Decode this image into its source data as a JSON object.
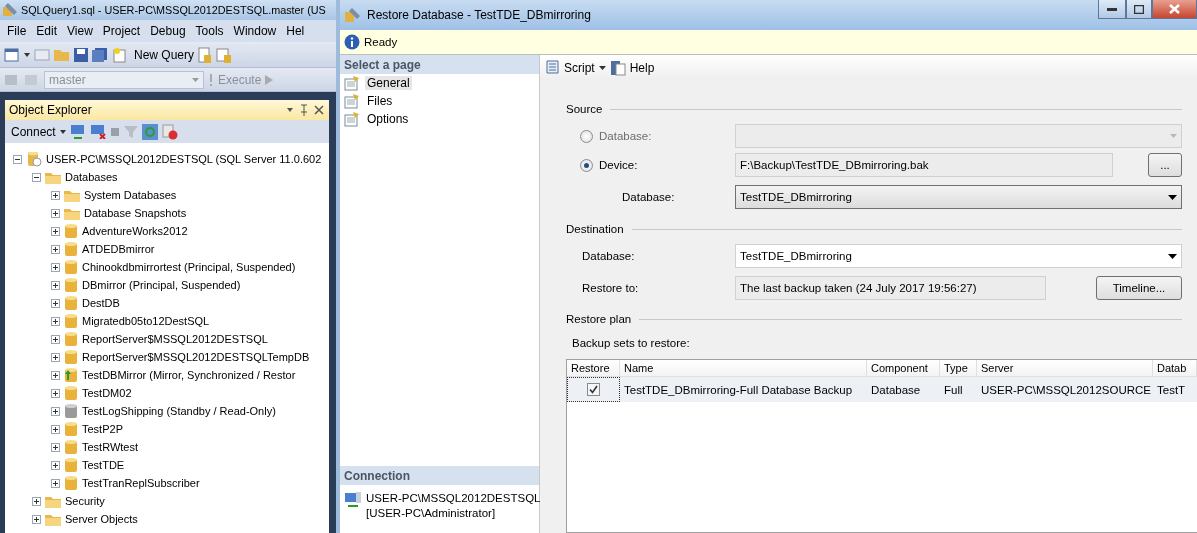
{
  "ssms": {
    "title": "SQLQuery1.sql - USER-PC\\MSSQL2012DESTSQL.master (US",
    "menu": [
      "File",
      "Edit",
      "View",
      "Project",
      "Debug",
      "Tools",
      "Window",
      "Hel"
    ],
    "toolbar": {
      "new_query": "New Query",
      "database": "master",
      "execute": "Execute"
    },
    "object_explorer": {
      "title": "Object Explorer",
      "connect": "Connect",
      "tree": [
        {
          "label": "USER-PC\\MSSQL2012DESTSQL (SQL Server 11.0.602",
          "kind": "server",
          "expanded": true,
          "children": [
            {
              "label": "Databases",
              "kind": "folder",
              "expanded": true,
              "children": [
                {
                  "label": "System Databases",
                  "kind": "folder",
                  "expanded": false
                },
                {
                  "label": "Database Snapshots",
                  "kind": "folder",
                  "expanded": false
                },
                {
                  "label": "AdventureWorks2012",
                  "kind": "database",
                  "expanded": false
                },
                {
                  "label": "ATDEDBmirror",
                  "kind": "database",
                  "expanded": false
                },
                {
                  "label": "Chinookdbmirrortest (Principal, Suspended)",
                  "kind": "database",
                  "expanded": false
                },
                {
                  "label": "DBmirror (Principal, Suspended)",
                  "kind": "database",
                  "expanded": false
                },
                {
                  "label": "DestDB",
                  "kind": "database",
                  "expanded": false
                },
                {
                  "label": "Migratedb05to12DestSQL",
                  "kind": "database",
                  "expanded": false
                },
                {
                  "label": "ReportServer$MSSQL2012DESTSQL",
                  "kind": "database",
                  "expanded": false
                },
                {
                  "label": "ReportServer$MSSQL2012DESTSQLTempDB",
                  "kind": "database",
                  "expanded": false
                },
                {
                  "label": "TestDBMirror (Mirror, Synchronized / Restor",
                  "kind": "mirror",
                  "expanded": false
                },
                {
                  "label": "TestDM02",
                  "kind": "database",
                  "expanded": false
                },
                {
                  "label": "TestLogShipping (Standby / Read-Only)",
                  "kind": "standby",
                  "expanded": false
                },
                {
                  "label": "TestP2P",
                  "kind": "database",
                  "expanded": false
                },
                {
                  "label": "TestRWtest",
                  "kind": "database",
                  "expanded": false
                },
                {
                  "label": "TestTDE",
                  "kind": "database",
                  "expanded": false
                },
                {
                  "label": "TestTranReplSubscriber",
                  "kind": "database",
                  "expanded": false
                }
              ]
            },
            {
              "label": "Security",
              "kind": "folder",
              "expanded": false
            },
            {
              "label": "Server Objects",
              "kind": "folder",
              "expanded": false
            }
          ]
        }
      ]
    }
  },
  "dialog": {
    "title": "Restore Database - TestTDE_DBmirroring",
    "status": "Ready",
    "pages_header": "Select a page",
    "pages": [
      {
        "label": "General",
        "selected": true
      },
      {
        "label": "Files",
        "selected": false
      },
      {
        "label": "Options",
        "selected": false
      }
    ],
    "connection": {
      "header": "Connection",
      "server": "USER-PC\\MSSQL2012DESTSQL",
      "user": "[USER-PC\\Administrator]"
    },
    "toolbar": {
      "script": "Script",
      "help": "Help"
    },
    "source": {
      "title": "Source",
      "options": [
        {
          "label": "Database:",
          "selected": false,
          "disabled": true
        },
        {
          "label": "Device:",
          "selected": true,
          "value": "F:\\Backup\\TestTDE_DBmirroring.bak",
          "browse": "..."
        }
      ],
      "database_label": "Database:",
      "database": "TestTDE_DBmirroring"
    },
    "destination": {
      "title": "Destination",
      "database_label": "Database:",
      "database": "TestTDE_DBmirroring",
      "restore_to_label": "Restore to:",
      "restore_to": "The last backup taken (24 July 2017 19:56:27)",
      "timeline": "Timeline..."
    },
    "restore_plan": {
      "title": "Restore plan",
      "caption": "Backup sets to restore:",
      "columns": [
        "Restore",
        "Name",
        "Component",
        "Type",
        "Server",
        "Datab"
      ],
      "rows": [
        {
          "checked": true,
          "name": "TestTDE_DBmirroring-Full Database Backup",
          "component": "Database",
          "type": "Full",
          "server": "USER-PC\\MSSQL2012SOURCE",
          "database": "TestT"
        }
      ]
    }
  }
}
